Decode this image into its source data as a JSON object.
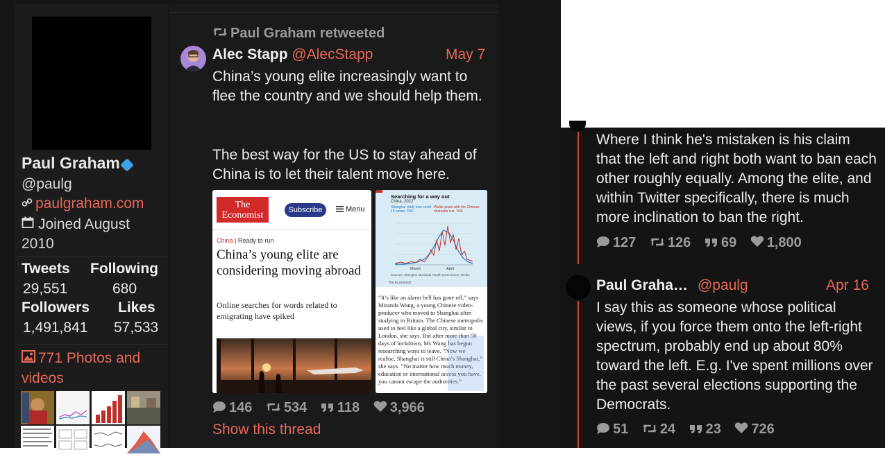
{
  "profile": {
    "name": "Paul Graham",
    "handle": "@paulg",
    "website": "paulgraham.com",
    "joined_line1": "Joined August",
    "joined_line2": "2010",
    "stats": {
      "tweets_label": "Tweets",
      "tweets_value": "29,551",
      "following_label": "Following",
      "following_value": "680",
      "followers_label": "Followers",
      "followers_value": "1,491,841",
      "likes_label": "Likes",
      "likes_value": "57,533"
    },
    "media_line1": "771 Photos and",
    "media_line2": "videos"
  },
  "main_tweet": {
    "retweet_label": "Paul Graham retweeted",
    "author": "Alec Stapp",
    "handle": "@AlecStapp",
    "date": "May 7",
    "text_p1": "China’s young elite increasingly want to flee the country and we should help them.",
    "text_p2": "The best way for the US to stay ahead of China is to let their talent move here.",
    "replies": "146",
    "retweets": "534",
    "quotes": "118",
    "likes": "3,966",
    "show_thread": "Show this thread",
    "media": {
      "logo_line1": "The",
      "logo_line2": "Economist",
      "subscribe": "Subscribe",
      "menu": "Menu",
      "kicker_section": "China",
      "kicker_rest": " | Ready to run",
      "headline": "China’s young elite are considering moving abroad",
      "dek": "Online searches for words related to emigrating have spiked",
      "chart_title": "Searching for a way out",
      "chart_sub": "China, 2022",
      "chart_leg1": "Shanghai, daily new covid-19 cases, '000",
      "chart_leg2": "Weibo posts with the Chinese character run, '000",
      "chart_month1": "March",
      "chart_month2": "April",
      "chart_source": "Sources: Shanghai Municipal Health Commission; Weibo",
      "chart_credit": "The Economist",
      "article_text": "“It’s like an alarm bell has gone off,” says Miranda Wang, a young Chinese video-producer who moved to Shanghai after studying in Britain. The Chinese metropolis used to feel like a global city, similar to London, she says. But after more than 50 days of lockdown, Ms Wang has begun researching ways to leave. “Now we realise, Shanghai is still China’s Shanghai,” she says. “No matter how much money, education or international access you have, you cannot escape the authorities.”"
    }
  },
  "thread": {
    "tweet1": {
      "text": "Where I think he's mistaken is his claim that the left and right both want to ban each other roughly equally. Among the elite, and within Twitter specifically, there is much more inclination to ban the right.",
      "replies": "127",
      "retweets": "126",
      "quotes": "69",
      "likes": "1,800"
    },
    "tweet2": {
      "author": "Paul Graha…",
      "handle": "@paulg",
      "date": "Apr 16",
      "text": "I say this as someone whose political views, if you force them onto the left-right spectrum, probably end up about 80% toward the left. E.g. I've spent millions over the past several elections supporting the Democrats.",
      "replies": "51",
      "retweets": "24",
      "quotes": "23",
      "likes": "726"
    }
  },
  "colors": {
    "accent": "#e8685a",
    "background": "#161616",
    "muted": "#9a9a9a",
    "verified": "#3da0e8"
  }
}
